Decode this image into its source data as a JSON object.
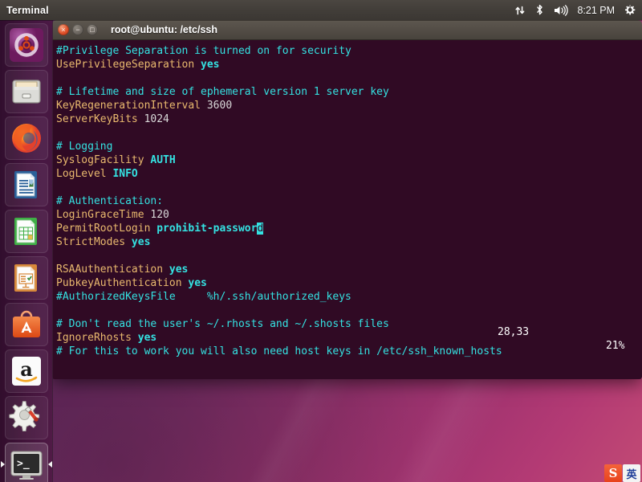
{
  "panel": {
    "app_title": "Terminal",
    "clock": "8:21 PM",
    "indicators": [
      {
        "name": "network-icon",
        "glyph": "⇅"
      },
      {
        "name": "bluetooth-icon",
        "glyph": "ᛦ"
      },
      {
        "name": "volume-icon",
        "glyph": "🔊"
      },
      {
        "name": "system-menu-icon",
        "glyph": "⚙"
      }
    ]
  },
  "launcher": {
    "items": [
      {
        "name": "dash-home",
        "label": "Ubuntu Dash Home",
        "icon": "ubuntu-logo-icon",
        "active": false
      },
      {
        "name": "files",
        "label": "Files",
        "icon": "file-cabinet-icon",
        "active": false
      },
      {
        "name": "firefox",
        "label": "Firefox Web Browser",
        "icon": "firefox-icon",
        "active": false
      },
      {
        "name": "writer",
        "label": "LibreOffice Writer",
        "icon": "document-icon",
        "active": false
      },
      {
        "name": "calc",
        "label": "LibreOffice Calc",
        "icon": "spreadsheet-icon",
        "active": false
      },
      {
        "name": "impress",
        "label": "LibreOffice Impress",
        "icon": "presentation-icon",
        "active": false
      },
      {
        "name": "software",
        "label": "Ubuntu Software",
        "icon": "software-bag-icon",
        "active": false
      },
      {
        "name": "amazon",
        "label": "Amazon",
        "icon": "amazon-icon",
        "active": false
      },
      {
        "name": "settings",
        "label": "System Settings",
        "icon": "gear-wrench-icon",
        "active": false
      },
      {
        "name": "terminal",
        "label": "Terminal",
        "icon": "terminal-icon",
        "active": true
      }
    ]
  },
  "terminal": {
    "title": "root@ubuntu: /etc/ssh",
    "window_buttons": {
      "close": "×",
      "minimize": "−",
      "maximize": "□"
    },
    "colors": {
      "background": "#300a24",
      "comment": "#34e2e2",
      "keyword": "#e9b96e",
      "value": "#ffffff",
      "cursor": "#34e2e2",
      "titlebar": "#524c45"
    },
    "lines": [
      [
        {
          "t": "#Privilege Separation is turned on for security",
          "c": "c-comment"
        }
      ],
      [
        {
          "t": "UsePrivilegeSeparation ",
          "c": "c-key"
        },
        {
          "t": "yes",
          "c": "c-bool"
        }
      ],
      [
        {
          "t": "",
          "c": ""
        }
      ],
      [
        {
          "t": "# Lifetime and size of ephemeral version 1 server key",
          "c": "c-comment"
        }
      ],
      [
        {
          "t": "KeyRegenerationInterval ",
          "c": "c-key"
        },
        {
          "t": "3600",
          "c": "c-num"
        }
      ],
      [
        {
          "t": "ServerKeyBits ",
          "c": "c-key"
        },
        {
          "t": "1024",
          "c": "c-num"
        }
      ],
      [
        {
          "t": "",
          "c": ""
        }
      ],
      [
        {
          "t": "# Logging",
          "c": "c-comment"
        }
      ],
      [
        {
          "t": "SyslogFacility ",
          "c": "c-key"
        },
        {
          "t": "AUTH",
          "c": "c-bool"
        }
      ],
      [
        {
          "t": "LogLevel ",
          "c": "c-key"
        },
        {
          "t": "INFO",
          "c": "c-bool"
        }
      ],
      [
        {
          "t": "",
          "c": ""
        }
      ],
      [
        {
          "t": "# Authentication:",
          "c": "c-comment"
        }
      ],
      [
        {
          "t": "LoginGraceTime ",
          "c": "c-key"
        },
        {
          "t": "120",
          "c": "c-num"
        }
      ],
      [
        {
          "t": "PermitRootLogin ",
          "c": "c-key"
        },
        {
          "t": "prohibit-passwor",
          "c": "c-bool"
        },
        {
          "t": "d",
          "c": "c-cursor"
        }
      ],
      [
        {
          "t": "StrictModes ",
          "c": "c-key"
        },
        {
          "t": "yes",
          "c": "c-bool"
        }
      ],
      [
        {
          "t": "",
          "c": ""
        }
      ],
      [
        {
          "t": "RSAAuthentication ",
          "c": "c-key"
        },
        {
          "t": "yes",
          "c": "c-bool"
        }
      ],
      [
        {
          "t": "PubkeyAuthentication ",
          "c": "c-key"
        },
        {
          "t": "yes",
          "c": "c-bool"
        }
      ],
      [
        {
          "t": "#AuthorizedKeysFile     %h/.ssh/authorized_keys",
          "c": "c-comment"
        }
      ],
      [
        {
          "t": "",
          "c": ""
        }
      ],
      [
        {
          "t": "# Don't read the user's ~/.rhosts and ~/.shosts files",
          "c": "c-comment"
        }
      ],
      [
        {
          "t": "IgnoreRhosts ",
          "c": "c-key"
        },
        {
          "t": "yes",
          "c": "c-bool"
        }
      ],
      [
        {
          "t": "# For this to work you will also need host keys in /etc/ssh_known_hosts",
          "c": "c-comment"
        }
      ]
    ],
    "status": {
      "position": "28,33",
      "percent": "21%"
    }
  },
  "ime": {
    "logo": "S",
    "lang": "英"
  }
}
